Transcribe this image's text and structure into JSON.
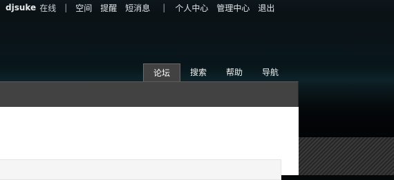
{
  "topbar": {
    "username": "djsuke",
    "status": "在线",
    "separator": "|",
    "links_group1": [
      "空间",
      "提醒",
      "短消息"
    ],
    "links_group2": [
      "个人中心",
      "管理中心",
      "退出"
    ]
  },
  "nav": {
    "items": [
      {
        "label": "论坛",
        "active": true
      },
      {
        "label": "搜索",
        "active": false
      },
      {
        "label": "帮助",
        "active": false
      },
      {
        "label": "导航",
        "active": false
      }
    ]
  },
  "colors": {
    "toolbar": "#424242",
    "content": "#ffffff",
    "header": "#0a1317"
  }
}
